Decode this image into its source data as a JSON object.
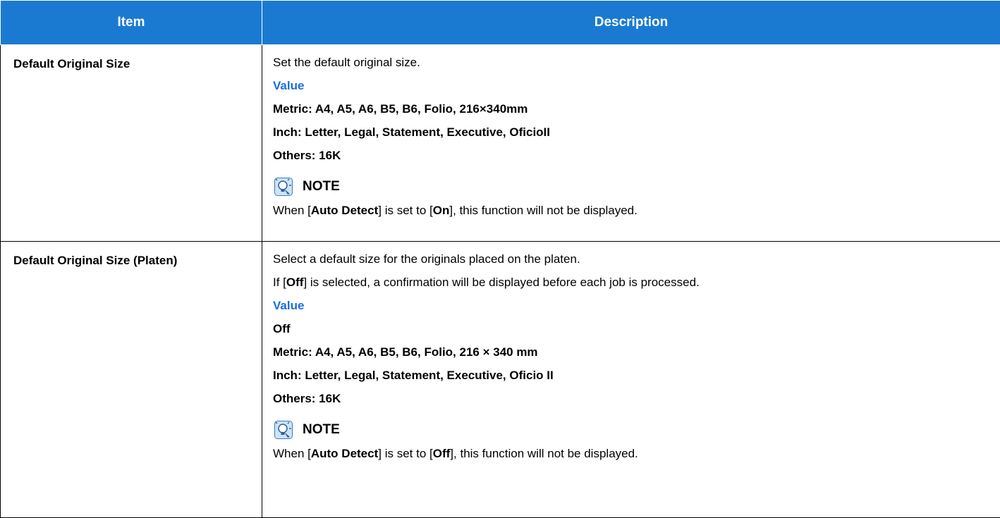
{
  "header": {
    "item": "Item",
    "description": "Description"
  },
  "rows": [
    {
      "item": "Default Original Size",
      "intro": [
        "Set the default original size."
      ],
      "value_heading": "Value",
      "values": [
        "Metric: A4, A5, A6, B5, B6, Folio, 216×340mm",
        "Inch: Letter, Legal, Statement, Executive, OficioII",
        "Others: 16K"
      ],
      "note_label": "NOTE",
      "note": {
        "pre": "When [",
        "key": "Auto Detect",
        "mid": "] is set to [",
        "state": "On",
        "post": "], this function will not be displayed."
      }
    },
    {
      "item": "Default Original Size (Platen)",
      "intro": [
        "Select a default size for the originals placed on the platen.",
        "If [Off] is selected, a confirmation will be displayed before each job is processed."
      ],
      "intro2_parts": {
        "pre": "If [",
        "key": "Off",
        "post": "] is selected, a confirmation will be displayed before each job is processed."
      },
      "value_heading": "Value",
      "values": [
        "Off",
        "Metric: A4, A5, A6, B5, B6, Folio, 216 × 340 mm",
        "Inch: Letter, Legal, Statement, Executive, Oficio II",
        "Others: 16K"
      ],
      "note_label": "NOTE",
      "note": {
        "pre": "When [",
        "key": "Auto Detect",
        "mid": "] is set to [",
        "state": "Off",
        "post": "], this function will not be displayed."
      }
    }
  ],
  "icons": {
    "note": "lightbulb-note-icon"
  },
  "colors": {
    "header_bg": "#1a7ad1",
    "value_heading": "#1a6ed8"
  }
}
